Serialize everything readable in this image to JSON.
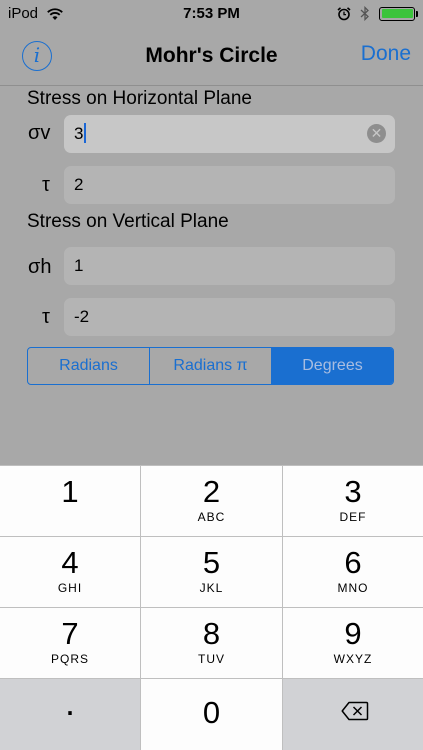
{
  "status": {
    "carrier": "iPod",
    "time": "7:53 PM"
  },
  "nav": {
    "title": "Mohr's Circle",
    "info_label": "i",
    "done_label": "Done"
  },
  "horizontal": {
    "heading": "Stress on Horizontal Plane",
    "sigma_label": "σv",
    "sigma_value": "3",
    "tau_label": "τ",
    "tau_value": "2"
  },
  "vertical": {
    "heading": "Stress on Vertical Plane",
    "sigma_label": "σh",
    "sigma_value": "1",
    "tau_label": "τ",
    "tau_value": "-2"
  },
  "angle_units": {
    "options": [
      "Radians",
      "Radians π",
      "Degrees"
    ],
    "selected": "Degrees"
  },
  "keypad": {
    "keys": [
      {
        "num": "1",
        "letters": ""
      },
      {
        "num": "2",
        "letters": "ABC"
      },
      {
        "num": "3",
        "letters": "DEF"
      },
      {
        "num": "4",
        "letters": "GHI"
      },
      {
        "num": "5",
        "letters": "JKL"
      },
      {
        "num": "6",
        "letters": "MNO"
      },
      {
        "num": "7",
        "letters": "PQRS"
      },
      {
        "num": "8",
        "letters": "TUV"
      },
      {
        "num": "9",
        "letters": "WXYZ"
      }
    ],
    "decimal": ".",
    "zero": "0"
  },
  "colors": {
    "accent": "#1a6fd0",
    "dimmed_background": "#a8a8a8"
  }
}
